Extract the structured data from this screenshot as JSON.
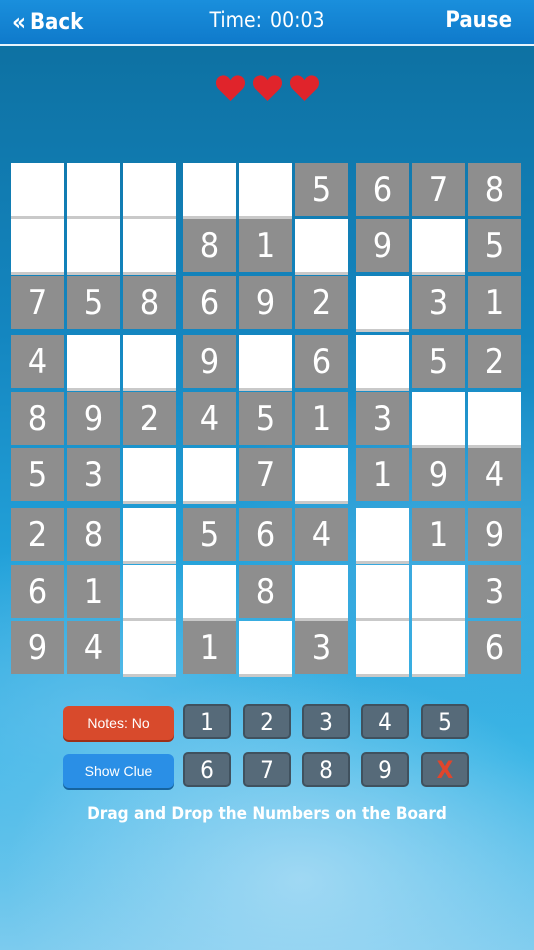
{
  "header": {
    "back_label": "Back",
    "back_icon": "double-chevron-left-icon",
    "time_label": "Time:",
    "time_value": "00:03",
    "pause_label": "Pause"
  },
  "lives": {
    "count": 3,
    "color": "#e0242b",
    "icon": "heart-icon"
  },
  "board": {
    "given_color": "#8e8e8e",
    "empty_color": "#ffffff",
    "cells": [
      [
        "",
        "",
        "",
        "",
        "",
        "5",
        "6",
        "7",
        "8"
      ],
      [
        "",
        "",
        "",
        "8",
        "1",
        "",
        "9",
        "",
        "5"
      ],
      [
        "7",
        "5",
        "8",
        "6",
        "9",
        "2",
        "",
        "3",
        "1"
      ],
      [
        "4",
        "",
        "",
        "9",
        "",
        "6",
        "",
        "5",
        "2"
      ],
      [
        "8",
        "9",
        "2",
        "4",
        "5",
        "1",
        "3",
        "",
        ""
      ],
      [
        "5",
        "3",
        "",
        "",
        "7",
        "",
        "1",
        "9",
        "4"
      ],
      [
        "2",
        "8",
        "",
        "5",
        "6",
        "4",
        "",
        "1",
        "9"
      ],
      [
        "6",
        "1",
        "",
        "",
        "8",
        "",
        "",
        "",
        "3"
      ],
      [
        "9",
        "4",
        "",
        "1",
        "",
        "3",
        "",
        "",
        "6"
      ]
    ]
  },
  "controls": {
    "notes_label": "Notes: No",
    "clue_label": "Show Clue",
    "numbers_row1": [
      "1",
      "2",
      "3",
      "4",
      "5"
    ],
    "numbers_row2": [
      "6",
      "7",
      "8",
      "9"
    ],
    "erase_label": "X",
    "notes_color": "#d84a2c",
    "clue_color": "#2a8fe6"
  },
  "instruction": "Drag and Drop the Numbers on the Board"
}
